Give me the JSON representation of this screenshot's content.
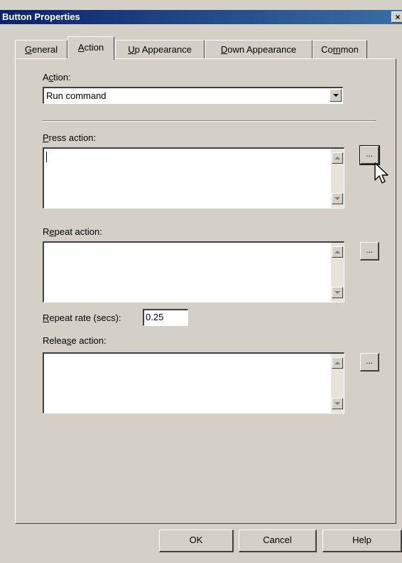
{
  "window": {
    "title": "Button Properties",
    "close_glyph": "×"
  },
  "tabs": [
    {
      "pre": "",
      "ul": "G",
      "post": "eneral",
      "active": false
    },
    {
      "pre": "",
      "ul": "A",
      "post": "ction",
      "active": true
    },
    {
      "pre": "",
      "ul": "U",
      "post": "p Appearance",
      "active": false
    },
    {
      "pre": "",
      "ul": "D",
      "post": "own Appearance",
      "active": false
    },
    {
      "pre": "Co",
      "ul": "m",
      "post": "mon",
      "active": false
    }
  ],
  "action": {
    "label_pre": "A",
    "label_ul": "c",
    "label_post": "tion:",
    "value": "Run command"
  },
  "press_action": {
    "label_pre": "",
    "label_ul": "P",
    "label_post": "ress action:",
    "value": "",
    "browse": "..."
  },
  "repeat_action": {
    "label_pre": "R",
    "label_ul": "e",
    "label_post": "peat action:",
    "value": "",
    "browse": "..."
  },
  "repeat_rate": {
    "label_pre": "",
    "label_ul": "R",
    "label_post": "epeat rate (secs):",
    "value": "0.25"
  },
  "release_action": {
    "label_pre": "Relea",
    "label_ul": "s",
    "label_post": "e action:",
    "value": "",
    "browse": "..."
  },
  "buttons": {
    "ok": "OK",
    "cancel": "Cancel",
    "help": "Help"
  }
}
